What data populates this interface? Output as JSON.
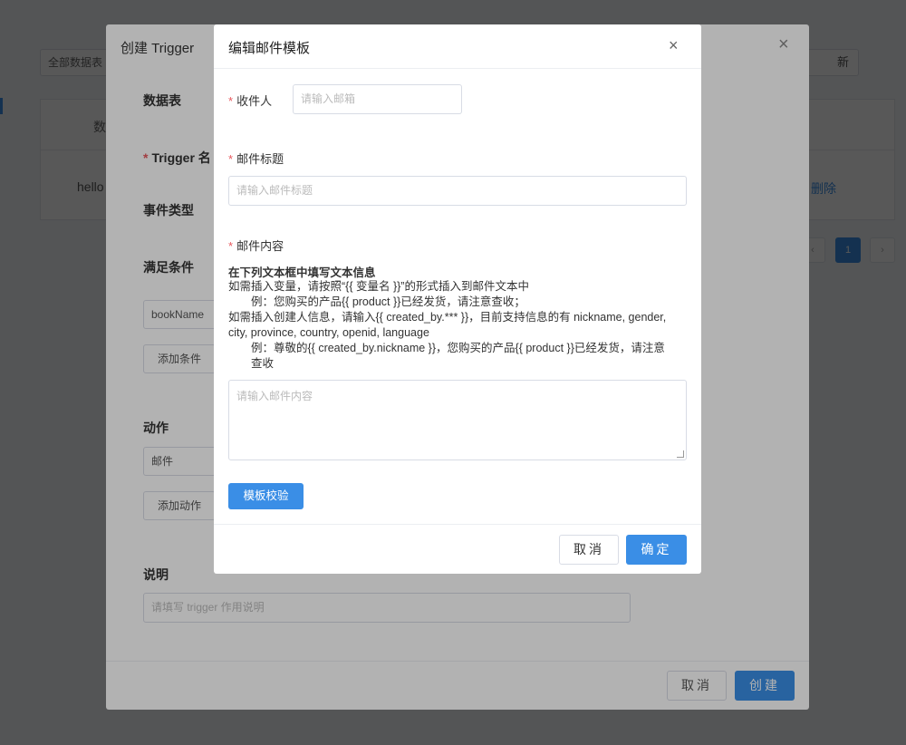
{
  "background": {
    "filter_text": "全部数据表",
    "refresh_label": "新",
    "table_header": "数",
    "table_cell": "hello",
    "delete_link": "删除",
    "pager": [
      "‹",
      "1",
      "›"
    ]
  },
  "create_dialog": {
    "title": "创建 Trigger",
    "close": "×",
    "table_label": "数据表",
    "trigger_name_label": "Trigger 名",
    "event_type_label": "事件类型",
    "condition_label": "满足条件",
    "condition_input": "bookName",
    "add_condition": "添加条件",
    "action_label": "动作",
    "action_input": "邮件",
    "add_action": "添加动作",
    "description_label": "说明",
    "description_placeholder": "请填写 trigger 作用说明",
    "cancel": "取消",
    "create": "创建"
  },
  "email_dialog": {
    "title": "编辑邮件模板",
    "close": "×",
    "recipient_label": "收件人",
    "recipient_placeholder": "请输入邮箱",
    "subject_label": "邮件标题",
    "subject_placeholder": "请输入邮件标题",
    "content_label": "邮件内容",
    "hint_title": "在下列文本框中填写文本信息",
    "hint_lines": [
      "如需插入变量，请按照“{{ 变量名 }}”的形式插入到邮件文本中",
      "例：您购买的产品{{ product }}已经发货，请注意查收；",
      "如需插入创建人信息，请输入{{ created_by.*** }}，目前支持信息的有 nickname, gender,",
      "city, province, country, openid, language",
      "例：尊敬的{{ created_by.nickname }}，您购买的产品{{ product }}已经发货，请注意",
      "查收"
    ],
    "content_placeholder": "请输入邮件内容",
    "validate": "模板校验",
    "cancel": "取消",
    "ok": "确定"
  },
  "colors": {
    "primary": "#3a8ee6",
    "required": "#e8585e"
  }
}
